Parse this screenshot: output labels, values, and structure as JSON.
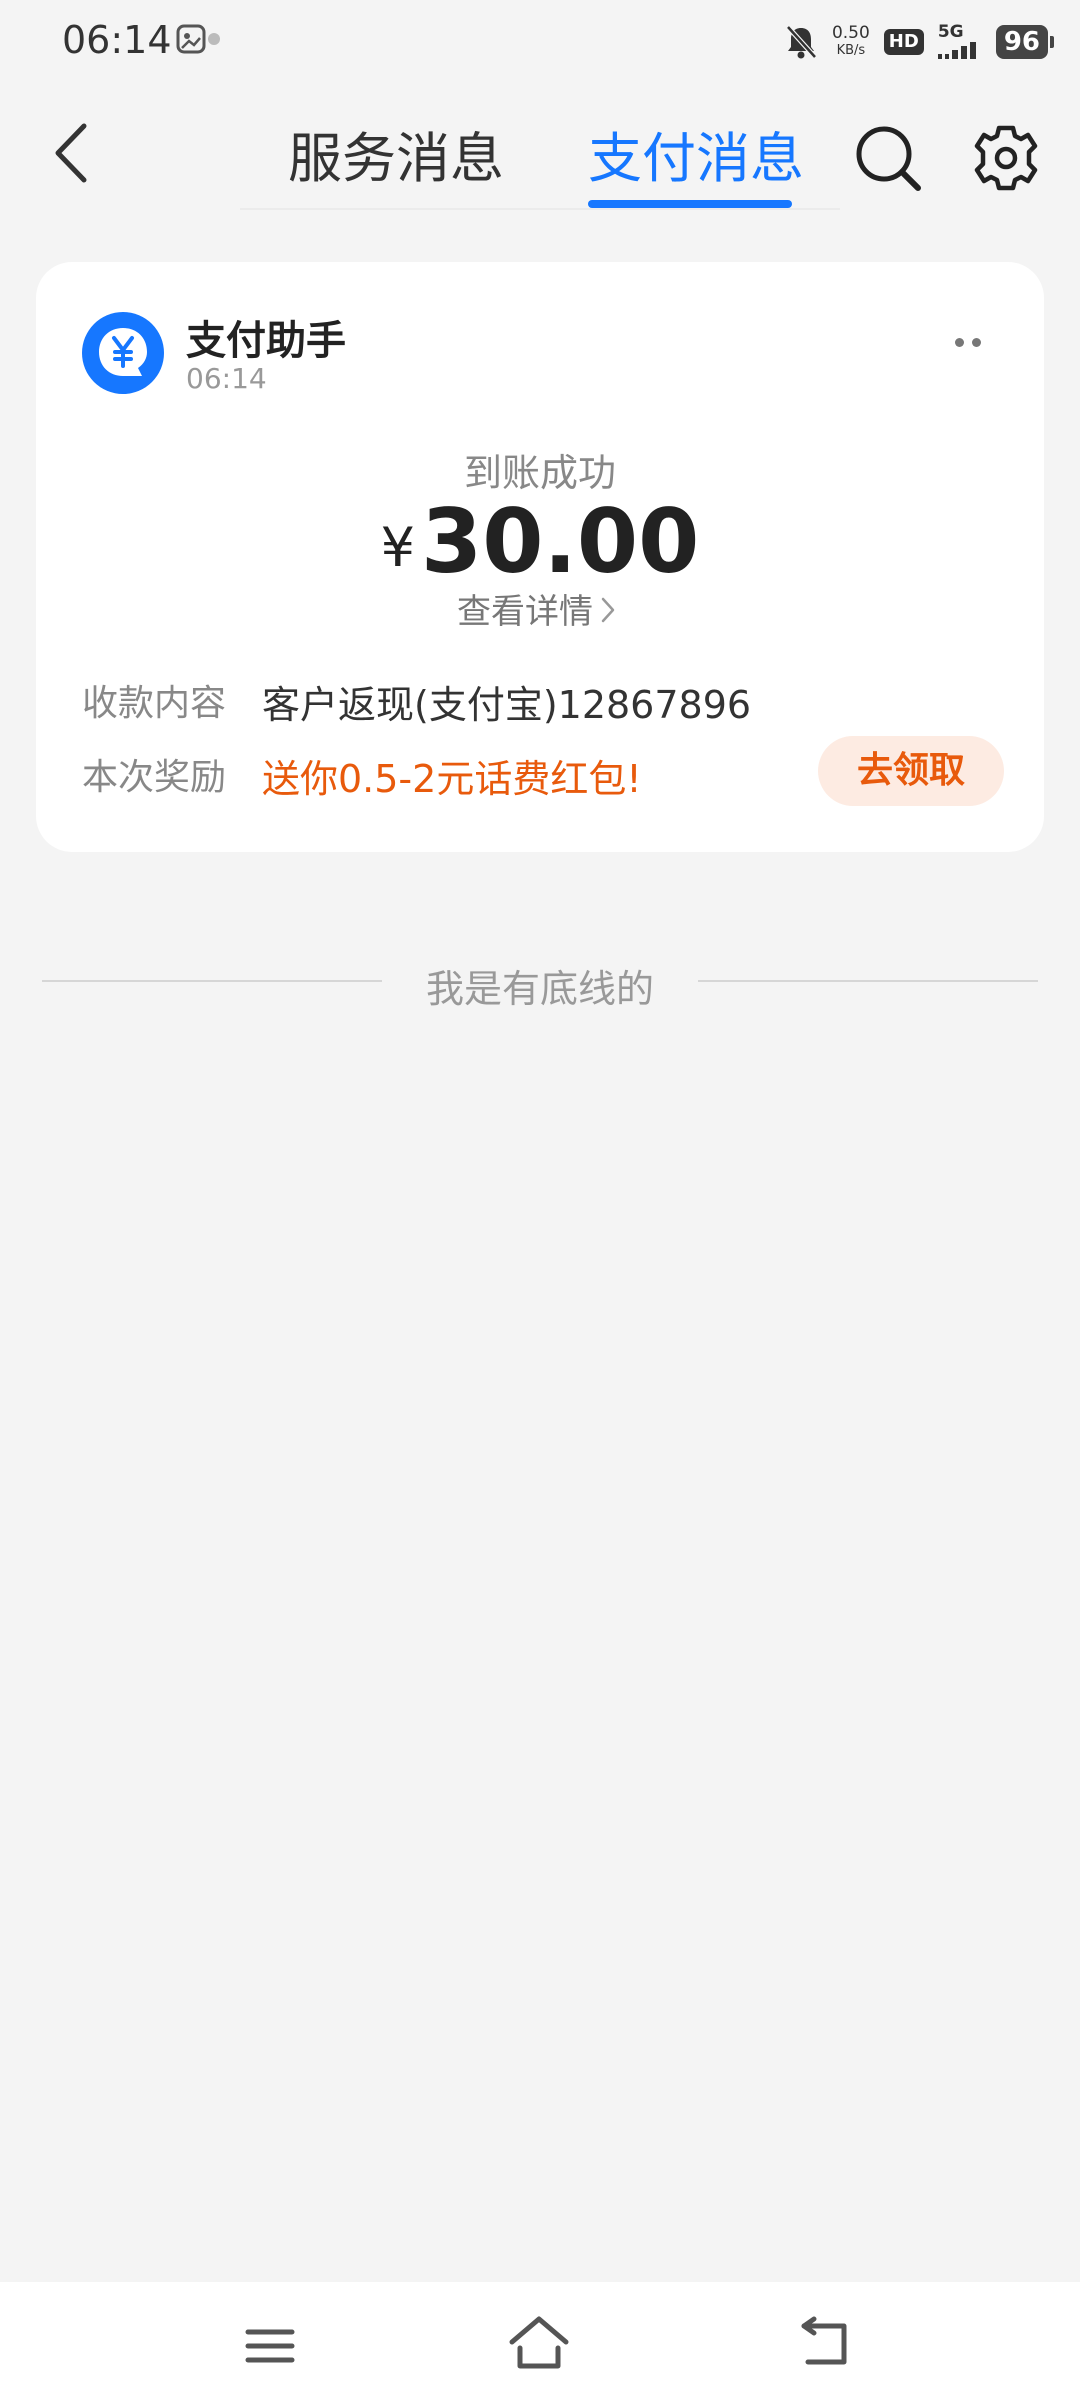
{
  "status_bar": {
    "time": "06:14",
    "net_speed_value": "0.50",
    "net_speed_unit": "KB/s",
    "hd": "HD",
    "network": "5G",
    "battery": "96",
    "icons": [
      "gallery-notification-icon",
      "mute-bell-icon",
      "signal-icon",
      "battery-icon"
    ]
  },
  "header": {
    "tabs": [
      {
        "label": "服务消息",
        "active": false
      },
      {
        "label": "支付消息",
        "active": true
      }
    ],
    "accent_color": "#1677ff",
    "icons": [
      "back-arrow-icon",
      "search-icon",
      "settings-gear-icon"
    ]
  },
  "message": {
    "sender_name": "支付助手",
    "sender_time": "06:14",
    "status": "到账成功",
    "currency": "¥",
    "amount": "30.00",
    "details_link": "查看详情",
    "rows": [
      {
        "label": "收款内容",
        "value": "客户返现(支付宝)12867896"
      },
      {
        "label": "本次奖励",
        "value": "送你0.5-2元话费红包!"
      }
    ],
    "claim_button": "去领取",
    "highlight_color": "#e85a0c"
  },
  "footer": {
    "end_text": "我是有底线的"
  },
  "navbar": {
    "icons": [
      "menu-icon",
      "home-icon",
      "back-icon"
    ]
  }
}
